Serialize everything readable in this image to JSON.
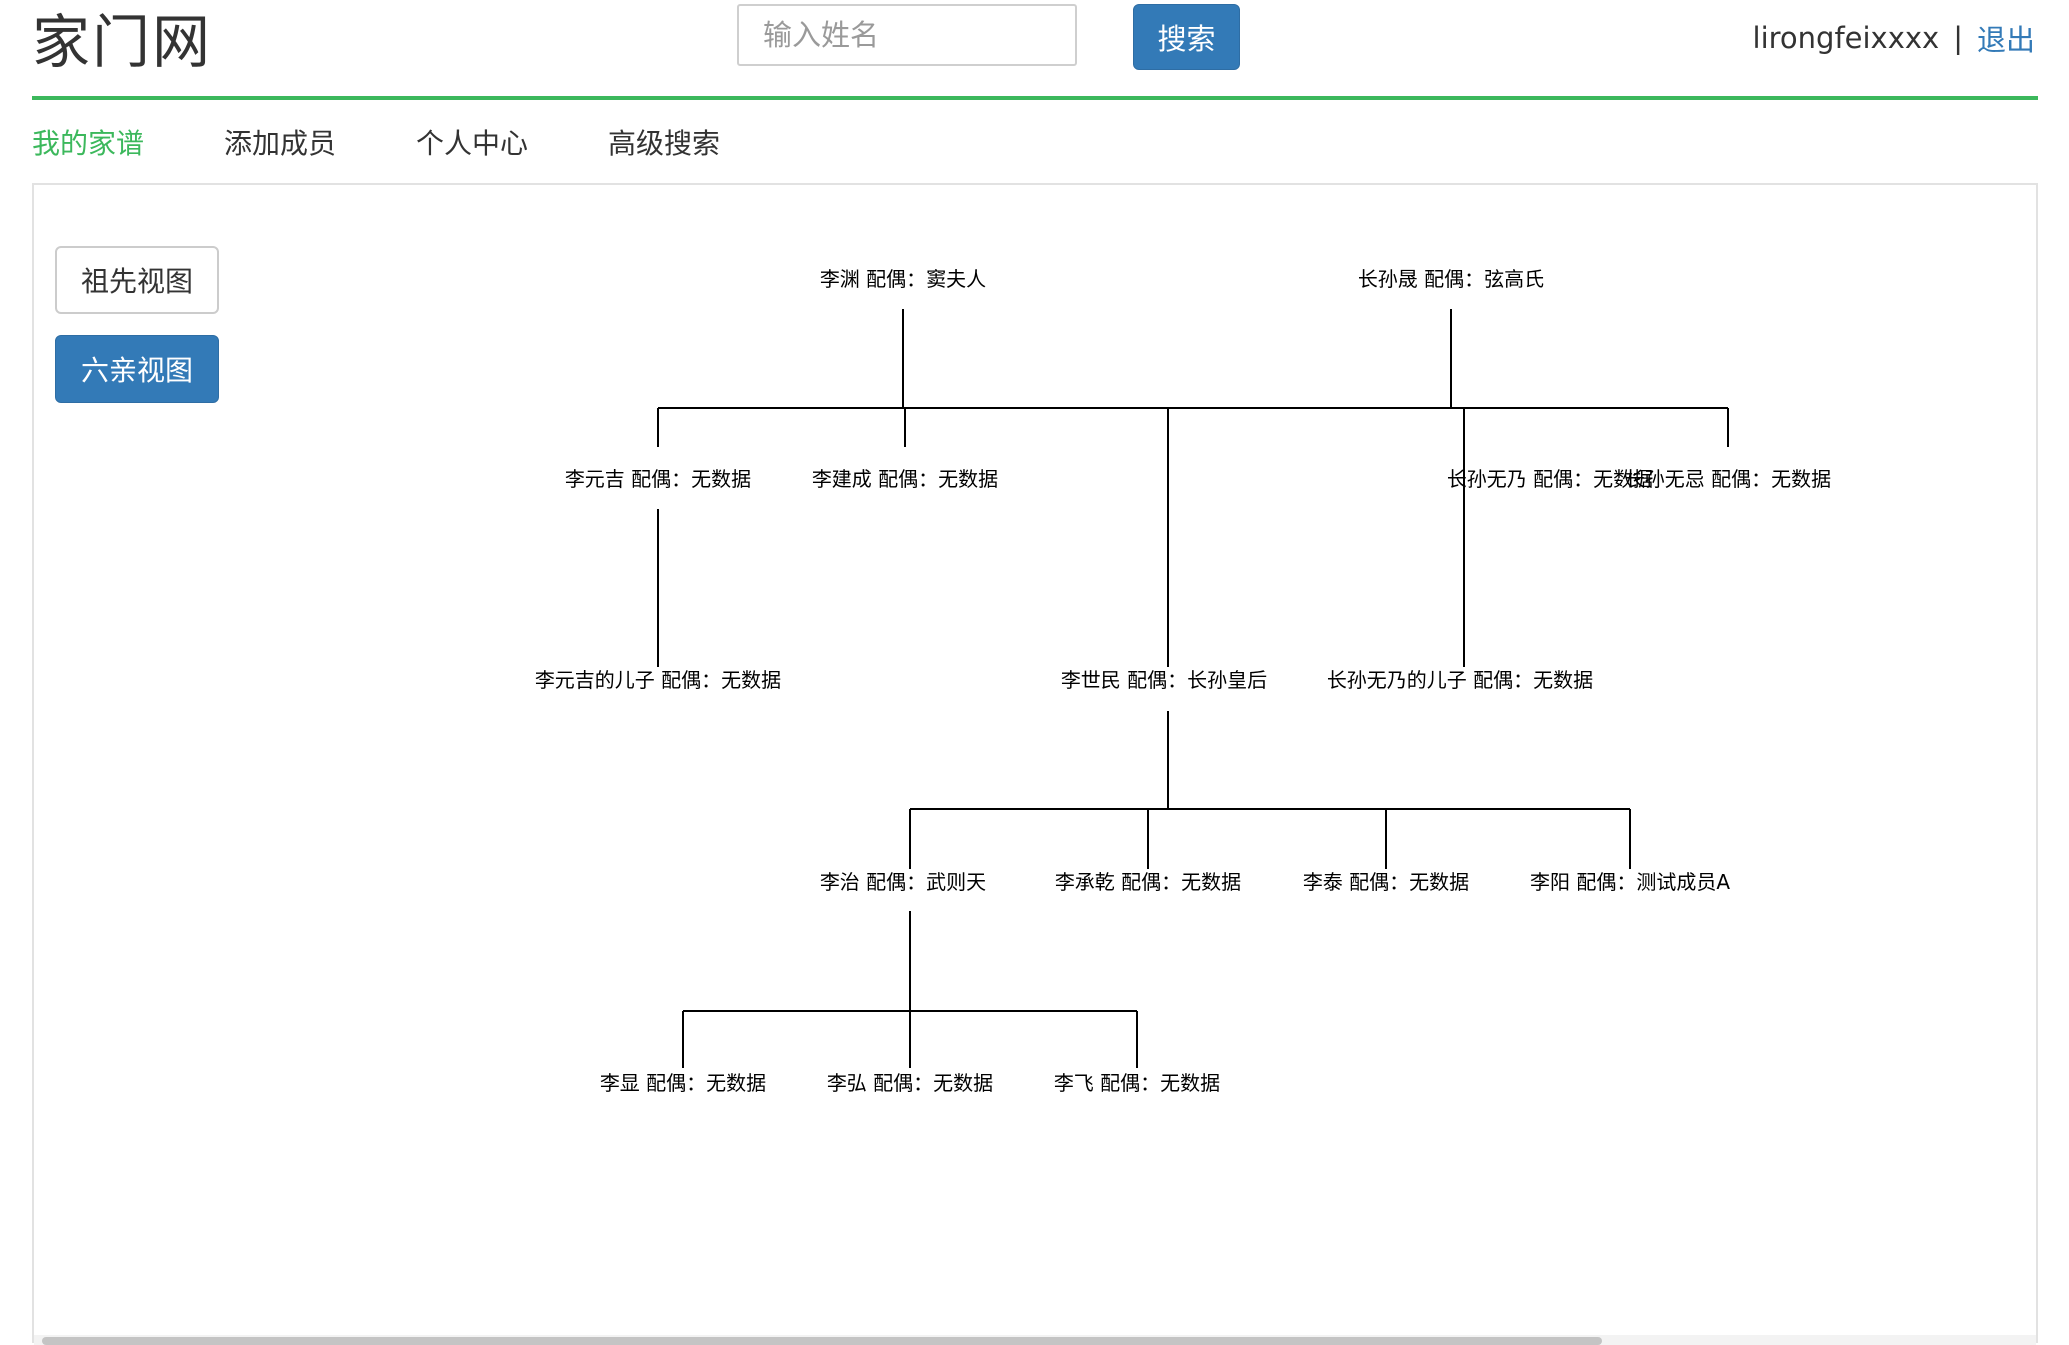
{
  "header": {
    "logo": "家门网",
    "search_placeholder": "输入姓名",
    "search_button": "搜索",
    "username": "lirongfeixxxx",
    "separator": "|",
    "logout": "退出"
  },
  "nav": [
    {
      "label": "我的家谱",
      "active": true
    },
    {
      "label": "添加成员",
      "active": false
    },
    {
      "label": "个人中心",
      "active": false
    },
    {
      "label": "高级搜索",
      "active": false
    }
  ],
  "view_buttons": {
    "ancestor_view": "祖先视图",
    "relatives_view": "六亲视图",
    "selected": "六亲视图"
  },
  "tree": {
    "spouse_label": "配偶：",
    "nodes": [
      {
        "id": "liyuan",
        "name": "李渊",
        "spouse": "窦夫人"
      },
      {
        "id": "zhangsunsheng",
        "name": "长孙晟",
        "spouse": "弦高氏"
      },
      {
        "id": "liyuanji",
        "name": "李元吉",
        "spouse": "无数据"
      },
      {
        "id": "lijiancheng",
        "name": "李建成",
        "spouse": "无数据"
      },
      {
        "id": "zhangsunwunai",
        "name": "长孙无乃",
        "spouse": "无数据"
      },
      {
        "id": "zhangsunwuji",
        "name": "长孙无忌",
        "spouse": "无数据"
      },
      {
        "id": "liyuanji_son",
        "name": "李元吉的儿子",
        "spouse": "无数据"
      },
      {
        "id": "lishimin",
        "name": "李世民",
        "spouse": "长孙皇后"
      },
      {
        "id": "zhangsunwunai_son",
        "name": "长孙无乃的儿子",
        "spouse": "无数据"
      },
      {
        "id": "lizhi",
        "name": "李治",
        "spouse": "武则天"
      },
      {
        "id": "lichengqian",
        "name": "李承乾",
        "spouse": "无数据"
      },
      {
        "id": "litai",
        "name": "李泰",
        "spouse": "无数据"
      },
      {
        "id": "liyang",
        "name": "李阳",
        "spouse": "测试成员A"
      },
      {
        "id": "lixian",
        "name": "李显",
        "spouse": "无数据"
      },
      {
        "id": "lihong",
        "name": "李弘",
        "spouse": "无数据"
      },
      {
        "id": "lifei",
        "name": "李飞",
        "spouse": "无数据"
      }
    ]
  }
}
